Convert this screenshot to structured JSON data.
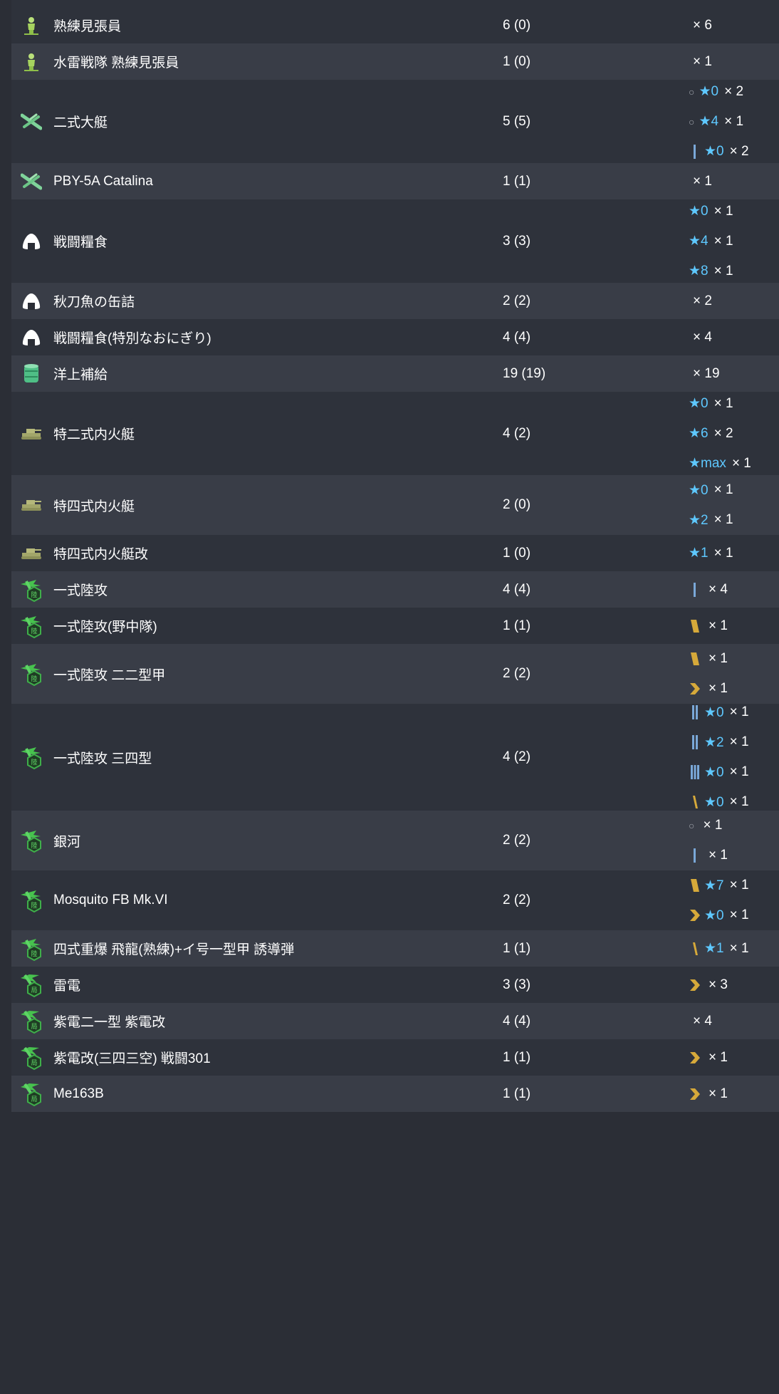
{
  "colors": {
    "row_dark": "#2e323b",
    "row_light": "#393d47",
    "star": "#5ec8ff",
    "text": "#ffffff"
  },
  "rows": [
    {
      "icon": "lookout-icon",
      "name": "熟練見張員",
      "count": "6 (0)",
      "dist": [
        {
          "prof": "",
          "star": "",
          "times": "× 6"
        }
      ]
    },
    {
      "icon": "lookout-icon",
      "name": "水雷戦隊 熟練見張員",
      "count": "1 (0)",
      "dist": [
        {
          "prof": "",
          "star": "",
          "times": "× 1"
        }
      ]
    },
    {
      "icon": "flying-boat-icon",
      "name": "二式大艇",
      "count": "5 (5)",
      "dist": [
        {
          "prof": "ring",
          "star": "★0",
          "times": "× 2"
        },
        {
          "prof": "ring",
          "star": "★4",
          "times": "× 1"
        },
        {
          "prof": "bar1",
          "star": "★0",
          "times": "× 2"
        }
      ]
    },
    {
      "icon": "flying-boat-icon",
      "name": "PBY-5A Catalina",
      "count": "1 (1)",
      "dist": [
        {
          "prof": "",
          "star": "",
          "times": "× 1"
        }
      ]
    },
    {
      "icon": "onigiri-icon",
      "name": "戦闘糧食",
      "count": "3 (3)",
      "dist": [
        {
          "prof": "",
          "star": "★0",
          "times": "× 1"
        },
        {
          "prof": "",
          "star": "★4",
          "times": "× 1"
        },
        {
          "prof": "",
          "star": "★8",
          "times": "× 1"
        }
      ]
    },
    {
      "icon": "onigiri-icon",
      "name": "秋刀魚の缶詰",
      "count": "2 (2)",
      "dist": [
        {
          "prof": "",
          "star": "",
          "times": "× 2"
        }
      ]
    },
    {
      "icon": "onigiri-icon",
      "name": "戦闘糧食(特別なおにぎり)",
      "count": "4 (4)",
      "dist": [
        {
          "prof": "",
          "star": "",
          "times": "× 4"
        }
      ]
    },
    {
      "icon": "drum-icon",
      "name": "洋上補給",
      "count": "19 (19)",
      "dist": [
        {
          "prof": "",
          "star": "",
          "times": "× 19"
        }
      ]
    },
    {
      "icon": "tank-icon",
      "name": "特二式内火艇",
      "count": "4 (2)",
      "dist": [
        {
          "prof": "",
          "star": "★0",
          "times": "× 1"
        },
        {
          "prof": "",
          "star": "★6",
          "times": "× 2"
        },
        {
          "prof": "",
          "star": "★max",
          "times": "× 1"
        }
      ]
    },
    {
      "icon": "tank-icon",
      "name": "特四式内火艇",
      "count": "2 (0)",
      "dist": [
        {
          "prof": "",
          "star": "★0",
          "times": "× 1"
        },
        {
          "prof": "",
          "star": "★2",
          "times": "× 1"
        }
      ]
    },
    {
      "icon": "tank-icon",
      "name": "特四式内火艇改",
      "count": "1 (0)",
      "dist": [
        {
          "prof": "",
          "star": "★1",
          "times": "× 1"
        }
      ]
    },
    {
      "icon": "land-attacker-icon",
      "name": "一式陸攻",
      "count": "4 (4)",
      "dist": [
        {
          "prof": "bar1",
          "star": "",
          "times": "× 4"
        }
      ]
    },
    {
      "icon": "land-attacker-icon",
      "name": "一式陸攻(野中隊)",
      "count": "1 (1)",
      "dist": [
        {
          "prof": "gold",
          "star": "",
          "times": "× 1"
        }
      ]
    },
    {
      "icon": "land-attacker-icon",
      "name": "一式陸攻 二二型甲",
      "count": "2 (2)",
      "dist": [
        {
          "prof": "gold",
          "star": "",
          "times": "× 1"
        },
        {
          "prof": "chevron",
          "star": "",
          "times": "× 1"
        }
      ]
    },
    {
      "icon": "land-attacker-icon",
      "name": "一式陸攻 三四型",
      "count": "4 (2)",
      "dist": [
        {
          "prof": "bar2",
          "star": "★0",
          "times": "× 1"
        },
        {
          "prof": "bar2",
          "star": "★2",
          "times": "× 1"
        },
        {
          "prof": "bar3",
          "star": "★0",
          "times": "× 1"
        },
        {
          "prof": "goldthin",
          "star": "★0",
          "times": "× 1"
        }
      ]
    },
    {
      "icon": "land-attacker-icon",
      "name": "銀河",
      "count": "2 (2)",
      "dist": [
        {
          "prof": "ring",
          "star": "",
          "times": "× 1"
        },
        {
          "prof": "bar1",
          "star": "",
          "times": "× 1"
        }
      ]
    },
    {
      "icon": "land-attacker-icon",
      "name": "Mosquito FB Mk.VI",
      "count": "2 (2)",
      "dist": [
        {
          "prof": "gold",
          "star": "★7",
          "times": "× 1"
        },
        {
          "prof": "chevron",
          "star": "★0",
          "times": "× 1"
        }
      ]
    },
    {
      "icon": "land-attacker-icon",
      "name": "四式重爆 飛龍(熟練)+イ号一型甲 誘導弾",
      "count": "1 (1)",
      "dist": [
        {
          "prof": "goldthin",
          "star": "★1",
          "times": "× 1"
        }
      ]
    },
    {
      "icon": "interceptor-icon",
      "name": "雷電",
      "count": "3 (3)",
      "dist": [
        {
          "prof": "chevron",
          "star": "",
          "times": "× 3"
        }
      ]
    },
    {
      "icon": "interceptor-icon",
      "name": "紫電二一型 紫電改",
      "count": "4 (4)",
      "dist": [
        {
          "prof": "",
          "star": "",
          "times": "× 4"
        }
      ]
    },
    {
      "icon": "interceptor-icon",
      "name": "紫電改(三四三空) 戦闘301",
      "count": "1 (1)",
      "dist": [
        {
          "prof": "chevron",
          "star": "",
          "times": "× 1"
        }
      ]
    },
    {
      "icon": "interceptor-icon",
      "name": "Me163B",
      "count": "1 (1)",
      "dist": [
        {
          "prof": "chevron",
          "star": "",
          "times": "× 1"
        }
      ]
    }
  ]
}
